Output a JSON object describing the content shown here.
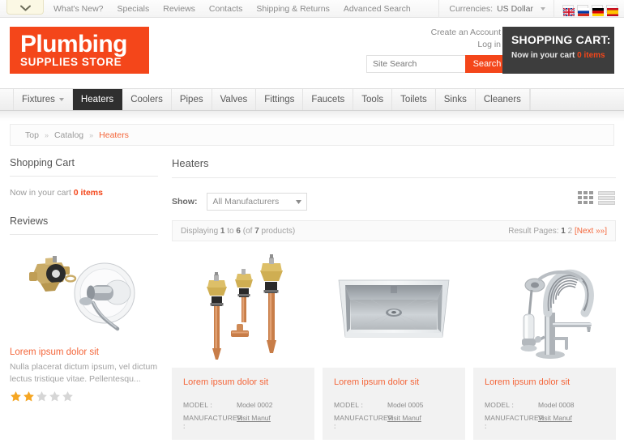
{
  "topbar": {
    "toggle_icon": "chevron-down-icon",
    "links": [
      "What's New?",
      "Specials",
      "Reviews",
      "Contacts",
      "Shipping & Returns",
      "Advanced Search"
    ],
    "currency_label": "Currencies:",
    "currency_value": "US Dollar",
    "flags": [
      "uk-flag",
      "russia-flag",
      "germany-flag",
      "spain-flag"
    ]
  },
  "header": {
    "logo_line1": "Plumbing",
    "logo_line2": "SUPPLIES STORE",
    "create_account": "Create an Account",
    "log_in": "Log in",
    "search_placeholder": "Site Search",
    "search_value": "",
    "search_button": "Search",
    "cart_title": "SHOPPING CART:",
    "cart_status_prefix": "Now in your cart",
    "cart_status_count": "0 items"
  },
  "nav": {
    "items": [
      {
        "label": "Fixtures",
        "has_caret": true,
        "active": false
      },
      {
        "label": "Heaters",
        "has_caret": false,
        "active": true
      },
      {
        "label": "Coolers",
        "has_caret": false,
        "active": false
      },
      {
        "label": "Pipes",
        "has_caret": false,
        "active": false
      },
      {
        "label": "Valves",
        "has_caret": false,
        "active": false
      },
      {
        "label": "Fittings",
        "has_caret": false,
        "active": false
      },
      {
        "label": "Faucets",
        "has_caret": false,
        "active": false
      },
      {
        "label": "Tools",
        "has_caret": false,
        "active": false
      },
      {
        "label": "Toilets",
        "has_caret": false,
        "active": false
      },
      {
        "label": "Sinks",
        "has_caret": false,
        "active": false
      },
      {
        "label": "Cleaners",
        "has_caret": false,
        "active": false
      }
    ]
  },
  "breadcrumb": {
    "top": "Top",
    "sep": "»",
    "catalog": "Catalog",
    "current": "Heaters"
  },
  "sidebar": {
    "cart_title": "Shopping Cart",
    "cart_line_prefix": "Now in your cart",
    "cart_line_count": "0 items",
    "reviews_title": "Reviews",
    "review": {
      "title": "Lorem ipsum dolor sit",
      "text": "Nulla placerat dictum ipsum, vel dictum lectus tristique vitae. Pellentesqu...",
      "rating": 2,
      "max_rating": 5,
      "image_alt": "shower-valve-trim"
    }
  },
  "main": {
    "title": "Heaters",
    "show_label": "Show:",
    "manufacturer_selected": "All Manufacturers",
    "view_grid_icon": "grid-view-icon",
    "view_list_icon": "list-view-icon",
    "displaying_prefix": "Displaying",
    "displaying_from": "1",
    "displaying_to_word": "to",
    "displaying_to": "6",
    "displaying_suffix": "(of",
    "displaying_total": "7",
    "displaying_end": "products)",
    "result_pages_label": "Result Pages:",
    "page_current": "1",
    "page_next_num": "2",
    "page_next_open": "[",
    "page_next_label": "Next",
    "page_next_arrow": "»»",
    "page_next_close": "]",
    "products": [
      {
        "title": "Lorem ipsum dolor sit",
        "model_key": "MODEL :",
        "model_value": "Model 0002",
        "manufacturer_key": "MANUFACTURER :",
        "manufacturer_value": "Visit Manuf",
        "image_alt": "copper-valve-fittings"
      },
      {
        "title": "Lorem ipsum dolor sit",
        "model_key": "MODEL :",
        "model_value": "Model 0005",
        "manufacturer_key": "MANUFACTURER :",
        "manufacturer_value": "Visit Manuf",
        "image_alt": "stainless-steel-sink"
      },
      {
        "title": "Lorem ipsum dolor sit",
        "model_key": "MODEL :",
        "model_value": "Model 0008",
        "manufacturer_key": "MANUFACTURER :",
        "manufacturer_value": "Visit Manuf",
        "image_alt": "pull-down-spring-faucet"
      }
    ]
  },
  "colors": {
    "brand_orange": "#f4461a",
    "link_orange": "#f4663a",
    "cart_dark": "#3d3d3d",
    "nav_active": "#2f2f2f",
    "star_on": "#f5a623",
    "star_off": "#d6d6d6"
  }
}
